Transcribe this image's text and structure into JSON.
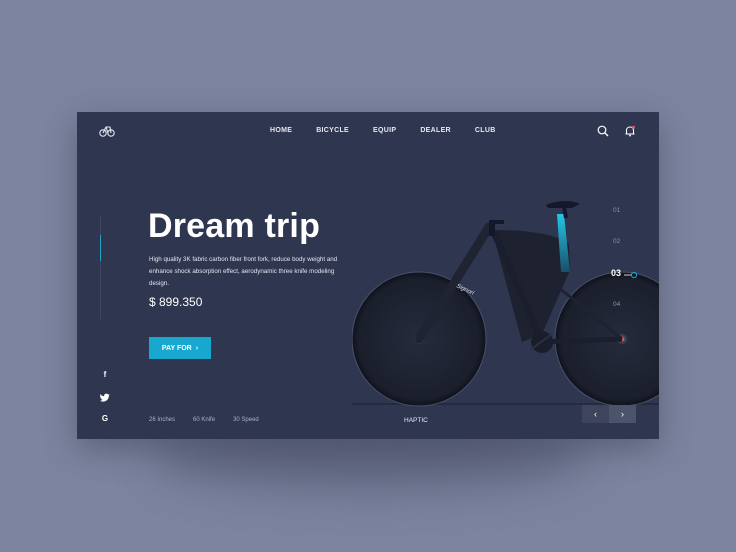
{
  "header": {
    "logo_icon": "bicycle-icon",
    "nav": [
      {
        "label": "HOME"
      },
      {
        "label": "BICYCLE"
      },
      {
        "label": "EQUIP"
      },
      {
        "label": "DEALER"
      },
      {
        "label": "CLUB"
      }
    ],
    "search_icon": "search-icon",
    "notification_icon": "bell-icon"
  },
  "hero": {
    "title": "Dream trip",
    "description": "High quality 3K fabric carbon fiber front fork, reduce body weight and enhance shock absorption effect, aerodynamic three knife modeling design.",
    "price": "$ 899.350",
    "button_label": "PAY FOR",
    "button_icon": "chevron-right-icon"
  },
  "social": [
    "f",
    "twitter-icon",
    "G"
  ],
  "specs": [
    "26 Inches",
    "60 Knife",
    "30 Speed"
  ],
  "product_label": "HAPTIC",
  "bike_brand": "Signori",
  "pager": {
    "items": [
      "01",
      "02",
      "03",
      "04"
    ],
    "active": "03"
  },
  "colors": {
    "background": "#7c849f",
    "card": "#2f3650",
    "accent": "#17a7cf"
  }
}
